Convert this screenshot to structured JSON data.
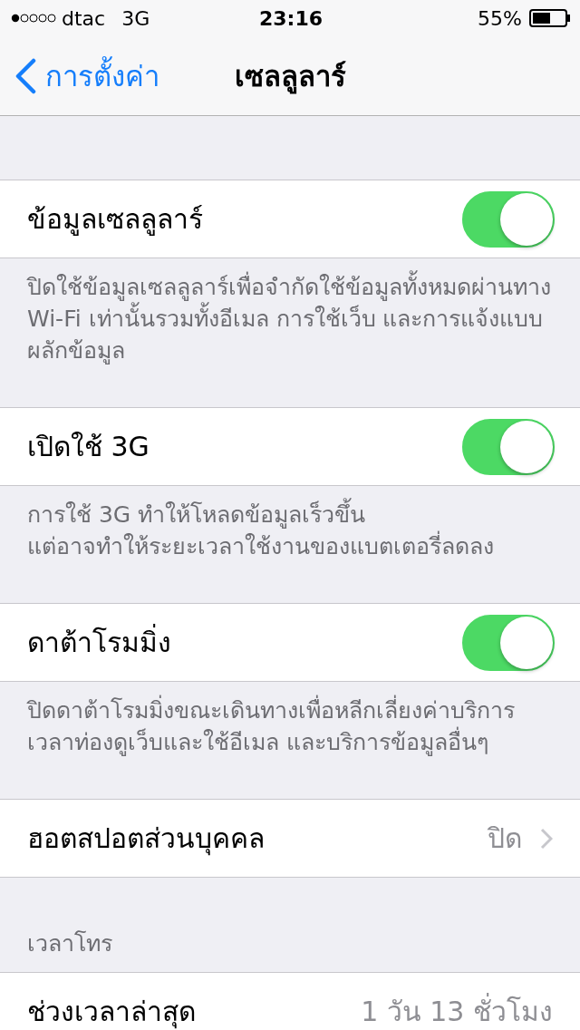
{
  "status_bar": {
    "carrier": "dtac",
    "network": "3G",
    "time": "23:16",
    "battery": "55%"
  },
  "nav": {
    "back": "การตั้งค่า",
    "title": "เซลลูลาร์"
  },
  "groups": [
    {
      "rows": [
        {
          "kind": "toggle",
          "label": "ข้อมูลเซลลูลาร์",
          "on": true
        }
      ],
      "footer": "ปิดใช้ข้อมูลเซลลูลาร์เพื่อจำกัดใช้ข้อมูลทั้งหมดผ่านทาง Wi-Fi เท่านั้นรวมทั้งอีเมล การใช้เว็บ และการแจ้งแบบผลักข้อมูล"
    },
    {
      "rows": [
        {
          "kind": "toggle",
          "label": "เปิดใช้ 3G",
          "on": true
        }
      ],
      "footer": "การใช้ 3G ทำให้โหลดข้อมูลเร็วขึ้น\nแต่อาจทำให้ระยะเวลาใช้งานของแบตเตอรี่ลดลง"
    },
    {
      "rows": [
        {
          "kind": "toggle",
          "label": "ดาต้าโรมมิ่ง",
          "on": true
        }
      ],
      "footer": "ปิดดาต้าโรมมิ่งขณะเดินทางเพื่อหลีกเลี่ยงค่าบริการ\nเวลาท่องดูเว็บและใช้อีเมล และบริการข้อมูลอื่นๆ"
    },
    {
      "rows": [
        {
          "kind": "disclosure",
          "label": "ฮอตสปอตส่วนบุคคล",
          "value": "ปิด"
        }
      ]
    },
    {
      "header": "เวลาโทร",
      "rows": [
        {
          "kind": "value",
          "label": "ช่วงเวลาล่าสุด",
          "value": "1 วัน 13 ชั่วโมง"
        }
      ]
    }
  ]
}
